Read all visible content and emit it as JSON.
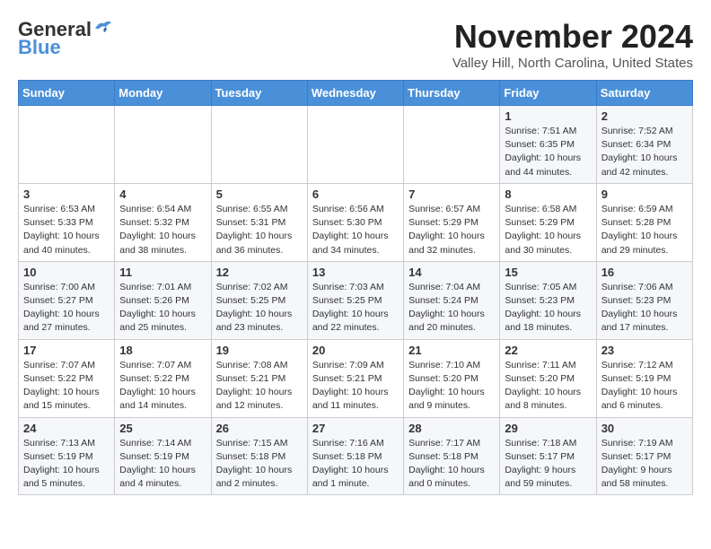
{
  "header": {
    "logo_general": "General",
    "logo_blue": "Blue",
    "month_title": "November 2024",
    "location": "Valley Hill, North Carolina, United States"
  },
  "days_of_week": [
    "Sunday",
    "Monday",
    "Tuesday",
    "Wednesday",
    "Thursday",
    "Friday",
    "Saturday"
  ],
  "weeks": [
    [
      {
        "day": "",
        "info": ""
      },
      {
        "day": "",
        "info": ""
      },
      {
        "day": "",
        "info": ""
      },
      {
        "day": "",
        "info": ""
      },
      {
        "day": "",
        "info": ""
      },
      {
        "day": "1",
        "info": "Sunrise: 7:51 AM\nSunset: 6:35 PM\nDaylight: 10 hours\nand 44 minutes."
      },
      {
        "day": "2",
        "info": "Sunrise: 7:52 AM\nSunset: 6:34 PM\nDaylight: 10 hours\nand 42 minutes."
      }
    ],
    [
      {
        "day": "3",
        "info": "Sunrise: 6:53 AM\nSunset: 5:33 PM\nDaylight: 10 hours\nand 40 minutes."
      },
      {
        "day": "4",
        "info": "Sunrise: 6:54 AM\nSunset: 5:32 PM\nDaylight: 10 hours\nand 38 minutes."
      },
      {
        "day": "5",
        "info": "Sunrise: 6:55 AM\nSunset: 5:31 PM\nDaylight: 10 hours\nand 36 minutes."
      },
      {
        "day": "6",
        "info": "Sunrise: 6:56 AM\nSunset: 5:30 PM\nDaylight: 10 hours\nand 34 minutes."
      },
      {
        "day": "7",
        "info": "Sunrise: 6:57 AM\nSunset: 5:29 PM\nDaylight: 10 hours\nand 32 minutes."
      },
      {
        "day": "8",
        "info": "Sunrise: 6:58 AM\nSunset: 5:29 PM\nDaylight: 10 hours\nand 30 minutes."
      },
      {
        "day": "9",
        "info": "Sunrise: 6:59 AM\nSunset: 5:28 PM\nDaylight: 10 hours\nand 29 minutes."
      }
    ],
    [
      {
        "day": "10",
        "info": "Sunrise: 7:00 AM\nSunset: 5:27 PM\nDaylight: 10 hours\nand 27 minutes."
      },
      {
        "day": "11",
        "info": "Sunrise: 7:01 AM\nSunset: 5:26 PM\nDaylight: 10 hours\nand 25 minutes."
      },
      {
        "day": "12",
        "info": "Sunrise: 7:02 AM\nSunset: 5:25 PM\nDaylight: 10 hours\nand 23 minutes."
      },
      {
        "day": "13",
        "info": "Sunrise: 7:03 AM\nSunset: 5:25 PM\nDaylight: 10 hours\nand 22 minutes."
      },
      {
        "day": "14",
        "info": "Sunrise: 7:04 AM\nSunset: 5:24 PM\nDaylight: 10 hours\nand 20 minutes."
      },
      {
        "day": "15",
        "info": "Sunrise: 7:05 AM\nSunset: 5:23 PM\nDaylight: 10 hours\nand 18 minutes."
      },
      {
        "day": "16",
        "info": "Sunrise: 7:06 AM\nSunset: 5:23 PM\nDaylight: 10 hours\nand 17 minutes."
      }
    ],
    [
      {
        "day": "17",
        "info": "Sunrise: 7:07 AM\nSunset: 5:22 PM\nDaylight: 10 hours\nand 15 minutes."
      },
      {
        "day": "18",
        "info": "Sunrise: 7:07 AM\nSunset: 5:22 PM\nDaylight: 10 hours\nand 14 minutes."
      },
      {
        "day": "19",
        "info": "Sunrise: 7:08 AM\nSunset: 5:21 PM\nDaylight: 10 hours\nand 12 minutes."
      },
      {
        "day": "20",
        "info": "Sunrise: 7:09 AM\nSunset: 5:21 PM\nDaylight: 10 hours\nand 11 minutes."
      },
      {
        "day": "21",
        "info": "Sunrise: 7:10 AM\nSunset: 5:20 PM\nDaylight: 10 hours\nand 9 minutes."
      },
      {
        "day": "22",
        "info": "Sunrise: 7:11 AM\nSunset: 5:20 PM\nDaylight: 10 hours\nand 8 minutes."
      },
      {
        "day": "23",
        "info": "Sunrise: 7:12 AM\nSunset: 5:19 PM\nDaylight: 10 hours\nand 6 minutes."
      }
    ],
    [
      {
        "day": "24",
        "info": "Sunrise: 7:13 AM\nSunset: 5:19 PM\nDaylight: 10 hours\nand 5 minutes."
      },
      {
        "day": "25",
        "info": "Sunrise: 7:14 AM\nSunset: 5:19 PM\nDaylight: 10 hours\nand 4 minutes."
      },
      {
        "day": "26",
        "info": "Sunrise: 7:15 AM\nSunset: 5:18 PM\nDaylight: 10 hours\nand 2 minutes."
      },
      {
        "day": "27",
        "info": "Sunrise: 7:16 AM\nSunset: 5:18 PM\nDaylight: 10 hours\nand 1 minute."
      },
      {
        "day": "28",
        "info": "Sunrise: 7:17 AM\nSunset: 5:18 PM\nDaylight: 10 hours\nand 0 minutes."
      },
      {
        "day": "29",
        "info": "Sunrise: 7:18 AM\nSunset: 5:17 PM\nDaylight: 9 hours\nand 59 minutes."
      },
      {
        "day": "30",
        "info": "Sunrise: 7:19 AM\nSunset: 5:17 PM\nDaylight: 9 hours\nand 58 minutes."
      }
    ]
  ],
  "colors": {
    "header_bg": "#4a90d9",
    "accent": "#4a90d9"
  }
}
